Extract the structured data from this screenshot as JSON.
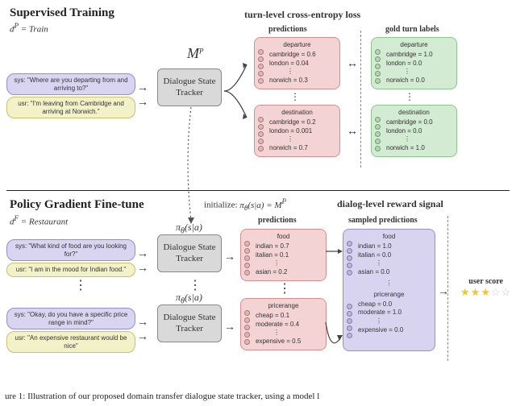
{
  "top": {
    "title": "Supervised Training",
    "domain_formula_prefix": "d",
    "domain_formula_sup": "P",
    "domain_formula_rest": "= Train",
    "loss_label": "turn-level cross-entropy loss",
    "pred_header": "predictions",
    "gold_header": "gold turn labels",
    "mp_symbol_m": "M",
    "mp_symbol_p": "P",
    "tracker": "Dialogue State Tracker",
    "sys_utt": "sys: \"Where are you departing from and arriving to?\"",
    "usr_utt": "usr: \"I'm leaving from Cambridge and arriving at Norwich.\"",
    "pred1": {
      "slot": "departure",
      "rows": [
        "cambridge = 0.6",
        "london   = 0.04",
        "norwich  = 0.3"
      ],
      "vdots_after_row": 1
    },
    "gold1": {
      "slot": "departure",
      "rows": [
        "cambridge = 1.0",
        "london   = 0.0",
        "norwich  = 0.0"
      ],
      "vdots_after_row": 1
    },
    "pred2": {
      "slot": "destination",
      "rows": [
        "cambridge = 0.2",
        "london   = 0.001",
        "norwich  = 0.7"
      ],
      "vdots_after_row": 1
    },
    "gold2": {
      "slot": "destination",
      "rows": [
        "cambridge = 0.0",
        "london   = 0.0",
        "norwich  = 1.0"
      ],
      "vdots_after_row": 1
    },
    "mid_vdots": "⋮"
  },
  "bottom": {
    "title": "Policy Gradient Fine-tune",
    "domain_formula_prefix": "d",
    "domain_formula_sup": "F",
    "domain_formula_rest": "= Restaurant",
    "init_label_pre": "initialize: ",
    "init_formula": "π_θ(s|a) = M",
    "init_formula_sup": "P",
    "reward_label": "dialog-level reward signal",
    "pred_header": "predictions",
    "sampled_header": "sampled predictions",
    "pi_label": "π_θ(s|a)",
    "tracker": "Dialogue State Tracker",
    "sys_utt1": "sys: \"What kind of food are you looking for?\"",
    "usr_utt1": "usr: \"I am in the mood for Indian food.\"",
    "sys_utt2": "sys: \"Okay, do you have a specific price range in mind?\"",
    "usr_utt2": "usr: \"An expensive restaurant would be nice\"",
    "pred1": {
      "slot": "food",
      "rows": [
        "indian  = 0.7",
        "italian = 0.1",
        "asian   = 0.2"
      ],
      "vdots_after_row": 1
    },
    "pred2": {
      "slot": "pricerange",
      "rows": [
        "cheap     = 0.1",
        "moderate  = 0.4",
        "expensive = 0.5"
      ],
      "vdots_after_row": 1
    },
    "sampled": {
      "slot1": "food",
      "rows1": [
        "indian  = 1.0",
        "italian = 0.0",
        "asian   = 0.0"
      ],
      "slot2": "pricerange",
      "rows2": [
        "cheap     = 0.0",
        "moderate  = 1.0",
        "expensive = 0.0"
      ]
    },
    "score_label": "user score",
    "stars_filled": 3,
    "stars_total": 5,
    "mid_vdots": "⋮"
  },
  "caption": "ure 1: Illustration of our proposed domain transfer dialogue state tracker, using a model l",
  "icons": {
    "arrow_right": "→",
    "arrow_bi": "↔"
  }
}
